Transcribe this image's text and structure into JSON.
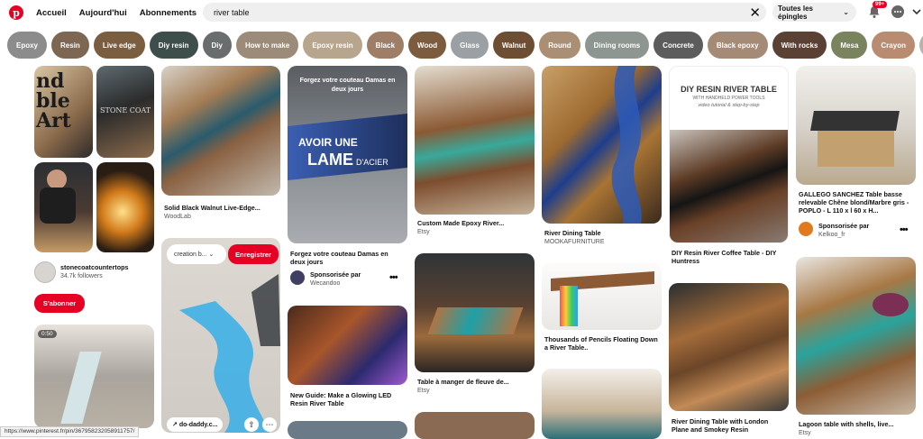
{
  "nav": {
    "home": "Accueil",
    "today": "Aujourd'hui",
    "following": "Abonnements"
  },
  "search": {
    "value": "river table",
    "placeholder": "Rechercher"
  },
  "scope": {
    "label": "Toutes les épingles"
  },
  "notifications": {
    "badge": "99+"
  },
  "pills": [
    {
      "label": "Epoxy",
      "color": "#8c8c8c"
    },
    {
      "label": "Resin",
      "color": "#7d6652"
    },
    {
      "label": "Live edge",
      "color": "#7b5d3f"
    },
    {
      "label": "Diy resin",
      "color": "#3e4e4a"
    },
    {
      "label": "Diy",
      "color": "#6a6d6d"
    },
    {
      "label": "How to make",
      "color": "#9c8b78"
    },
    {
      "label": "Epoxy resin",
      "color": "#b8a58d"
    },
    {
      "label": "Black",
      "color": "#9f7e68"
    },
    {
      "label": "Wood",
      "color": "#7c5b3f"
    },
    {
      "label": "Glass",
      "color": "#9aa0a4"
    },
    {
      "label": "Walnut",
      "color": "#6e4e33"
    },
    {
      "label": "Round",
      "color": "#ab8f75"
    },
    {
      "label": "Dining rooms",
      "color": "#8d9690"
    },
    {
      "label": "Concrete",
      "color": "#5c5c5c"
    },
    {
      "label": "Black epoxy",
      "color": "#a58a76"
    },
    {
      "label": "With rocks",
      "color": "#5a4133"
    },
    {
      "label": "Mesa",
      "color": "#79835e"
    },
    {
      "label": "Crayon",
      "color": "#b98b70"
    },
    {
      "label": "Ideas",
      "color": "#b9b2ab"
    }
  ],
  "pins": {
    "board_user": {
      "name": "stonecoatcountertops",
      "followers": "34.7k followers",
      "subscribe": "S'abonner"
    },
    "p1": {
      "title": "Solid Black Walnut Live-Edge...",
      "source": "WoodLab"
    },
    "p2": {
      "overlay": "creation b...",
      "save": "Enregistrer",
      "link": "do-daddy.c..."
    },
    "p3": {
      "headline": "Forgez votre couteau Damas en deux jours",
      "big": "AVOIR UNE",
      "big2": "LAME",
      "big3": "D'ACIER",
      "title": "Forgez votre couteau Damas en deux jours",
      "sponsor": "Sponsorisée par",
      "source": "Wecandoo"
    },
    "p4": {
      "title": "New Guide: Make a Glowing LED Resin River Table"
    },
    "p5": {
      "title": "Custom Made Epoxy River...",
      "source": "Etsy"
    },
    "p6": {
      "title": "Table à manger de fleuve de...",
      "source": "Etsy"
    },
    "p7": {
      "title": "River Dining Table",
      "source": "MOOKAFURNITURE"
    },
    "p8": {
      "title": "Thousands of Pencils Floating Down a River Table.."
    },
    "p9": {
      "header": "DIY RESIN RIVER TABLE",
      "sub": "WITH HANDHELD POWER TOOLS",
      "sub2": "video tutorial & step-by-step",
      "title": "DIY Resin River Coffee Table - DIY Huntress"
    },
    "p10": {
      "title": "River Dining Table with London Plane and Smokey Resin"
    },
    "p11": {
      "title": "GALLEGO SANCHEZ Table basse relevable Chêne blond/Marbre gris - POPLO - L 110 x l 60 x H...",
      "sponsor": "Sponsorisée par",
      "source": "Kelkoo_fr"
    },
    "p12": {
      "title": "Lagoon table with shells, live...",
      "source": "Etsy"
    },
    "video": {
      "duration": "0:50"
    }
  },
  "status_url": "https://www.pinterest.fr/pin/367958232058911757/"
}
